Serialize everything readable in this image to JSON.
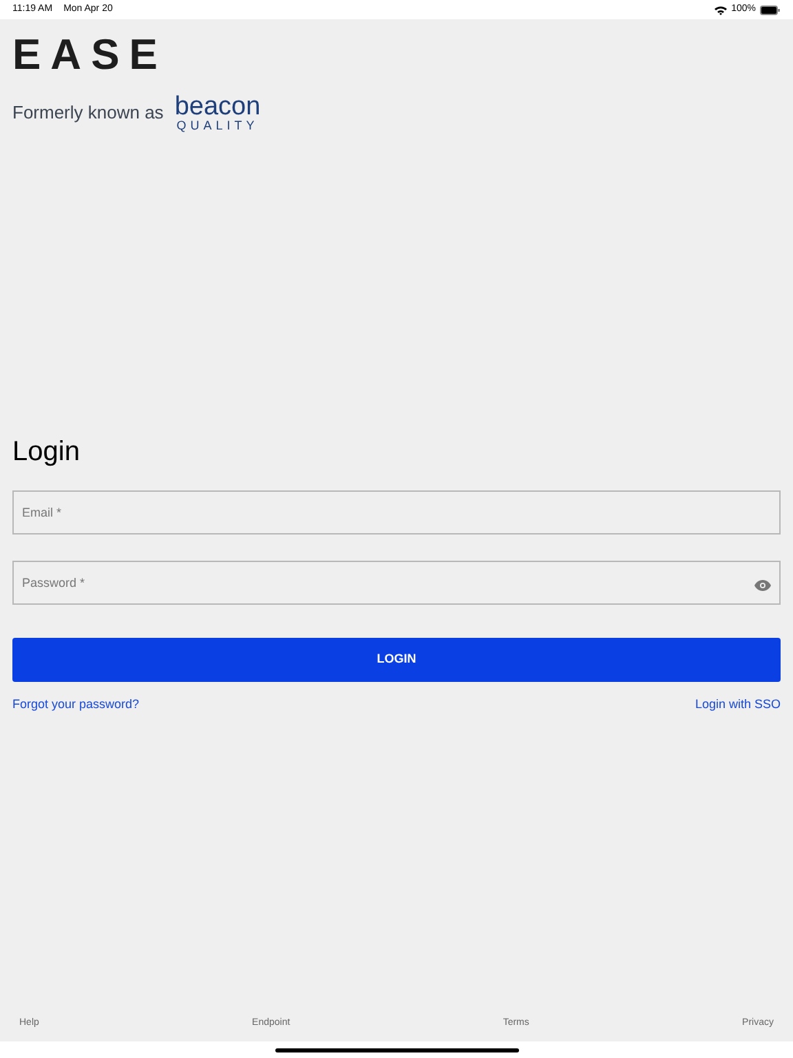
{
  "status_bar": {
    "time": "11:19 AM",
    "date": "Mon Apr 20",
    "battery": "100%"
  },
  "logo": {
    "text": "EASE"
  },
  "formerly": {
    "label": "Formerly known as",
    "brand_name": "beacon",
    "brand_subtitle": "QUALITY"
  },
  "heading": "Login",
  "email": {
    "placeholder": "Email *"
  },
  "password": {
    "placeholder": "Password *"
  },
  "login_button": "LOGIN",
  "links": [
    "Forgot your password?",
    "Login with SSO"
  ],
  "footer": [
    "Help",
    "Endpoint",
    "Terms",
    "Privacy"
  ]
}
